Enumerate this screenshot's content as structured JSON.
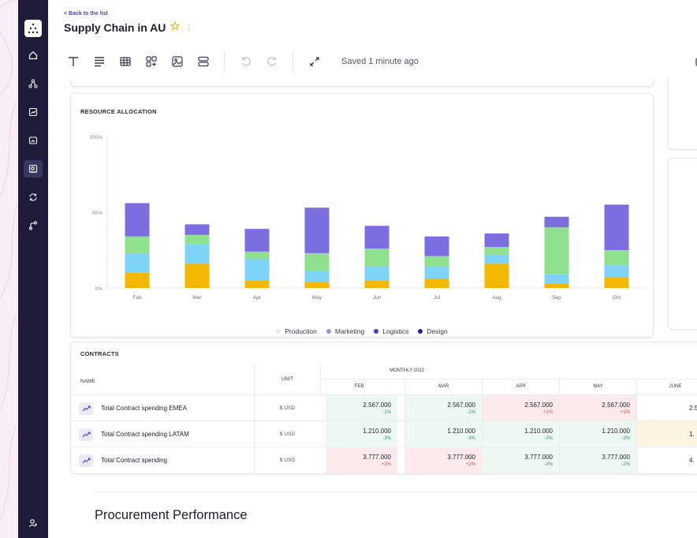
{
  "header": {
    "back_link": "< Back to the list",
    "title": "Supply Chain in AU"
  },
  "toolbar": {
    "saved_status": "Saved 1 minute ago"
  },
  "resource_chart": {
    "title": "RESOURCE ALLOCATION"
  },
  "chart_data": {
    "type": "bar",
    "stacked": true,
    "categories": [
      "Feb",
      "Mar",
      "Apr",
      "May",
      "Jun",
      "Jul",
      "Aug",
      "Sep",
      "Oct"
    ],
    "ylim": [
      0,
      100
    ],
    "y_ticks": [
      "0%",
      "50%",
      "100%"
    ],
    "series": [
      {
        "name": "Production",
        "color": "#f5b800",
        "values": [
          10,
          16,
          5,
          4,
          5,
          6,
          16,
          3,
          7
        ]
      },
      {
        "name": "Marketing",
        "color": "#7dd3f8",
        "values": [
          13,
          13,
          14,
          7,
          9,
          8,
          6,
          6,
          8
        ]
      },
      {
        "name": "Logistics",
        "color": "#8fe08f",
        "values": [
          11,
          6,
          5,
          12,
          12,
          7,
          5,
          31,
          10
        ]
      },
      {
        "name": "Design",
        "color": "#7b6ee0",
        "values": [
          22,
          7,
          15,
          30,
          15,
          13,
          9,
          7,
          30
        ]
      }
    ],
    "legend": [
      {
        "label": "Production",
        "color": "#e9e7f5"
      },
      {
        "label": "Marketing",
        "color": "#9a8ff0"
      },
      {
        "label": "Logistics",
        "color": "#4b3fc9"
      },
      {
        "label": "Design",
        "color": "#2a1fa8"
      }
    ],
    "legend_position": "bottom"
  },
  "contracts": {
    "title": "CONTRACTS",
    "col_name": "NAME",
    "col_unit": "UNIT",
    "group_header": "MONTHLY 2023",
    "months": [
      "FEB",
      "MAR",
      "APR",
      "MAY",
      "JUNE"
    ],
    "rows": [
      {
        "name": "Total Contract spending EMEA",
        "unit": "$ USD",
        "cells": [
          {
            "value": "2.567.000",
            "delta": "-1%",
            "dir": "neg"
          },
          {
            "value": "2.567.000",
            "delta": "-1%",
            "dir": "neg"
          },
          {
            "value": "2.567.000",
            "delta": "+1%",
            "dir": "pos"
          },
          {
            "value": "2.567.000",
            "delta": "+1%",
            "dir": "pos"
          },
          {
            "value": "2.5",
            "delta": "",
            "dir": "none"
          }
        ]
      },
      {
        "name": "Total Contract spending LATAM",
        "unit": "$ USD",
        "cells": [
          {
            "value": "1.210.000",
            "delta": "-3%",
            "dir": "neg"
          },
          {
            "value": "1.210.000",
            "delta": "-3%",
            "dir": "neg"
          },
          {
            "value": "1.210.000",
            "delta": "-3%",
            "dir": "neg"
          },
          {
            "value": "1.210.000",
            "delta": "-3%",
            "dir": "neg"
          },
          {
            "value": "1.",
            "delta": "",
            "dir": "none"
          }
        ]
      },
      {
        "name": "Total Contract spending",
        "unit": "$ USD",
        "cells": [
          {
            "value": "3.777.000",
            "delta": "+2%",
            "dir": "pos"
          },
          {
            "value": "3.777.000",
            "delta": "+2%",
            "dir": "pos"
          },
          {
            "value": "3.777.000",
            "delta": "-2%",
            "dir": "neg"
          },
          {
            "value": "3.777.000",
            "delta": "-2%",
            "dir": "neg"
          },
          {
            "value": "4.",
            "delta": "",
            "dir": "none"
          }
        ]
      }
    ],
    "colors": {
      "pos_bg": "#fdeaea",
      "neg_bg": "#eef8f3",
      "neutral_bg": "#fdf3e1"
    }
  },
  "section": {
    "heading": "Procurement Performance"
  }
}
